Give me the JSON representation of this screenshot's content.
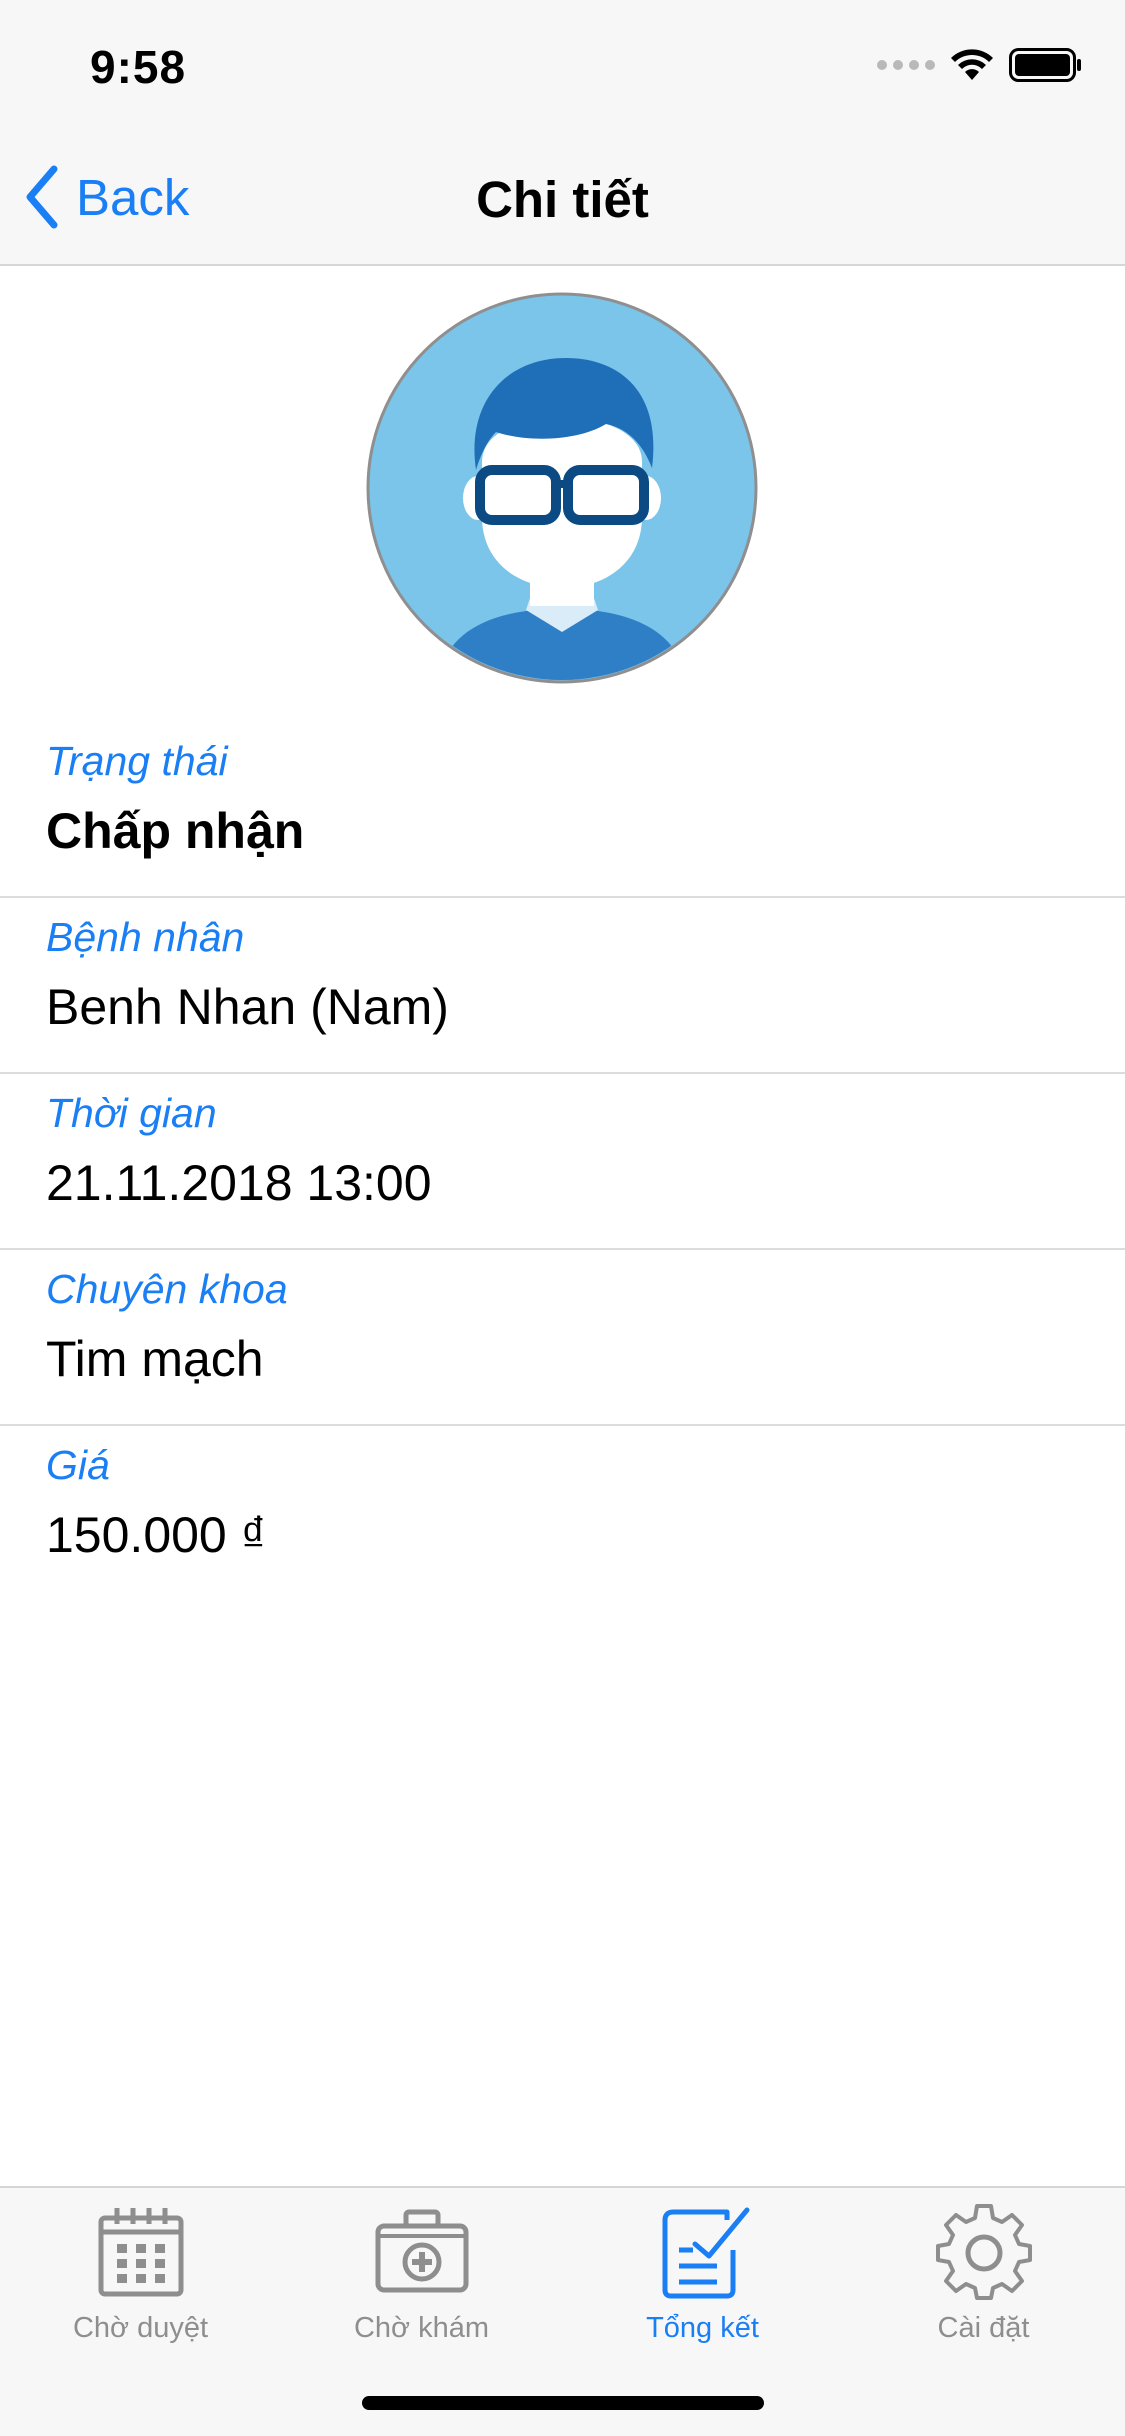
{
  "status": {
    "time": "9:58"
  },
  "nav": {
    "back_label": "Back",
    "title": "Chi tiết"
  },
  "details": [
    {
      "label": "Trạng thái",
      "value": "Chấp nhận"
    },
    {
      "label": "Bệnh nhân",
      "value": "Benh Nhan (Nam)"
    },
    {
      "label": "Thời gian",
      "value": "21.11.2018 13:00"
    },
    {
      "label": "Chuyên khoa",
      "value": "Tim mạch"
    },
    {
      "label": "Giá",
      "value": "150.000 ₫"
    }
  ],
  "tabs": [
    {
      "label": "Chờ duyệt",
      "icon": "calendar-icon",
      "active": false
    },
    {
      "label": "Chờ khám",
      "icon": "medical-kit-icon",
      "active": false
    },
    {
      "label": "Tổng kết",
      "icon": "checklist-icon",
      "active": true
    },
    {
      "label": "Cài đặt",
      "icon": "gear-icon",
      "active": false
    }
  ],
  "colors": {
    "accent": "#1a7ef5",
    "inactive_tab": "#8e8e8e",
    "bar_background": "#f7f7f7"
  }
}
